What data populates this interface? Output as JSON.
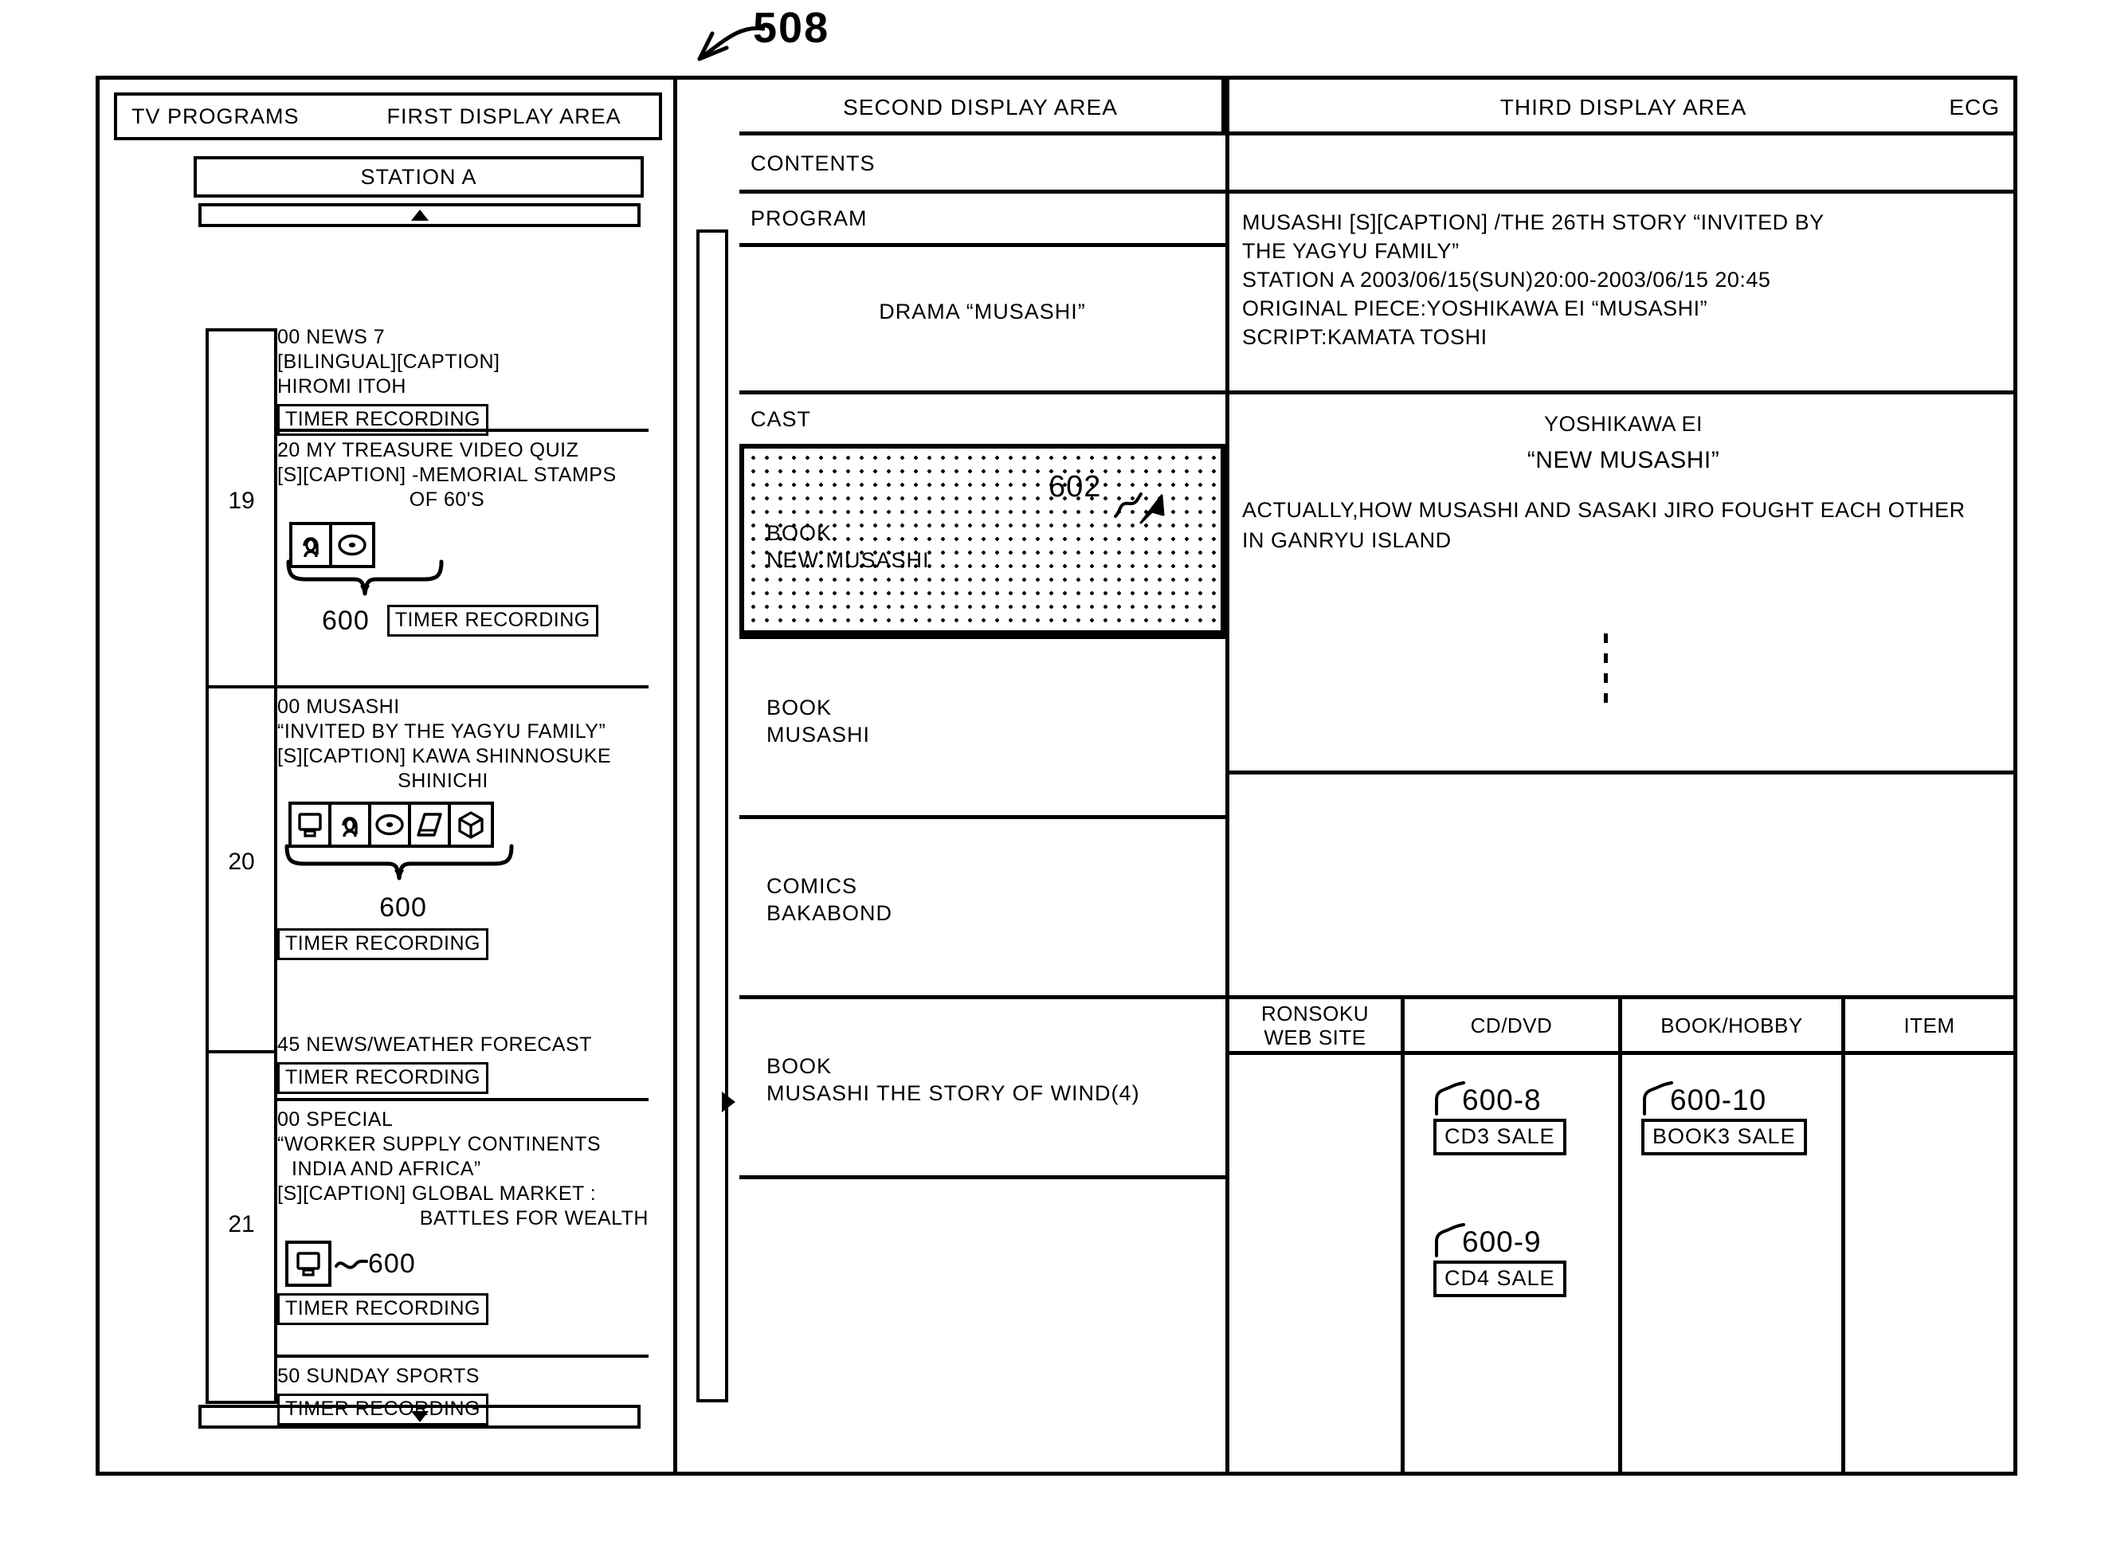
{
  "figure": {
    "number": "508"
  },
  "first_display_area": {
    "header": {
      "left_label": "TV PROGRAMS",
      "right_label": "FIRST DISPLAY AREA"
    },
    "station": "STATION A",
    "scroll_up_icon": "triangle-up-icon",
    "scroll_down_icon": "triangle-down-icon",
    "hours": [
      "19",
      "20",
      "21"
    ],
    "programs": [
      {
        "time": "00",
        "title": "NEWS 7",
        "line2": "[BILINGUAL][CAPTION]",
        "line3": "HIROMI ITOH",
        "timer_label": "TIMER RECORDING"
      },
      {
        "time": "20",
        "title": "MY TREASURE VIDEO QUIZ",
        "line2": "[S][CAPTION] -MEMORIAL STAMPS",
        "line3": "OF 60'S",
        "icons": [
          "person-icon",
          "disc-icon"
        ],
        "ref": "600",
        "timer_label": "TIMER RECORDING"
      },
      {
        "time": "00",
        "title": "MUSASHI",
        "line2": "“INVITED BY THE YAGYU FAMILY”",
        "line3": "[S][CAPTION] KAWA SHINNOSUKE",
        "line4": "SHINICHI",
        "icons": [
          "monitor-icon",
          "person-icon",
          "disc-icon",
          "book-icon",
          "box-icon"
        ],
        "ref": "600",
        "timer_label": "TIMER RECORDING"
      },
      {
        "time": "45",
        "title": "NEWS/WEATHER FORECAST",
        "timer_label": "TIMER RECORDING"
      },
      {
        "time": "00",
        "title": "SPECIAL",
        "line2": "“WORKER SUPPLY CONTINENTS",
        "line3": "INDIA AND AFRICA”",
        "line4": "[S][CAPTION] GLOBAL MARKET :",
        "line5": "BATTLES FOR WEALTH",
        "icons": [
          "monitor-icon"
        ],
        "ref": "600",
        "timer_label": "TIMER RECORDING"
      },
      {
        "time": "50",
        "title": "SUNDAY SPORTS",
        "timer_label": "TIMER RECORDING"
      }
    ]
  },
  "scrollbar": {
    "arrow_icon": "triangle-right-icon"
  },
  "second_display_area": {
    "header": "SECOND DISPLAY AREA",
    "rows": [
      {
        "label": "CONTENTS"
      },
      {
        "label": "PROGRAM"
      },
      {
        "label": "DRAMA “MUSASHI”"
      },
      {
        "label": "CAST"
      },
      {
        "label": "BOOK\nNEW MUSASHI",
        "selected": true,
        "ref": "602",
        "cursor": "arrow-cursor-icon"
      },
      {
        "label": "BOOK\nMUSASHI"
      },
      {
        "label": "COMICS\nBAKABOND"
      },
      {
        "label": "BOOK\nMUSASHI THE STORY OF WIND(4)"
      }
    ]
  },
  "third_display_area": {
    "header": "THIRD DISPLAY AREA",
    "ecg": "ECG",
    "program_detail": "MUSASHI [S][CAPTION] /THE 26TH STORY “INVITED BY\nTHE YAGYU FAMILY”\nSTATION A 2003/06/15(SUN)20:00-2003/06/15 20:45\nORIGINAL PIECE:YOSHIKAWA EI “MUSASHI”\nSCRIPT:KAMATA TOSHI",
    "book_author": "YOSHIKAWA EI",
    "book_title": "“NEW MUSASHI”",
    "book_desc": "ACTUALLY,HOW MUSASHI AND SASAKI JIRO FOUGHT EACH OTHER\nIN GANRYU ISLAND",
    "ellipsis": "vertical-ellipsis-icon",
    "subtable": {
      "columns": [
        "RONSOKU\nWEB SITE",
        "CD/DVD",
        "BOOK/HOBBY",
        "ITEM"
      ],
      "cd_dvd": [
        {
          "ref": "600-8",
          "label": "CD3 SALE"
        },
        {
          "ref": "600-9",
          "label": "CD4 SALE"
        }
      ],
      "book_hobby": [
        {
          "ref": "600-10",
          "label": "BOOK3 SALE"
        }
      ],
      "ronsoku": [],
      "item": []
    }
  },
  "colors": {
    "ink": "#000000",
    "paper": "#ffffff"
  }
}
